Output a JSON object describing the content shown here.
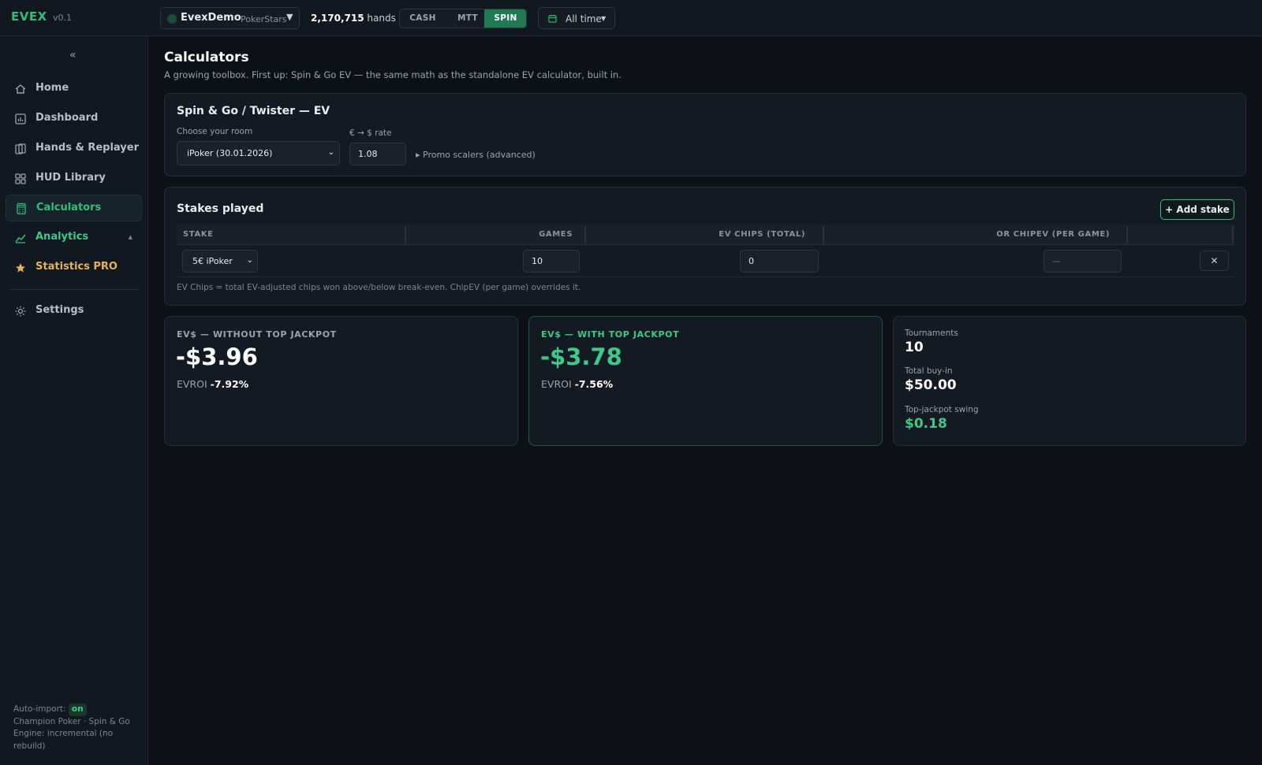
{
  "app": {
    "logo": "EVEX",
    "version": "v0.1"
  },
  "topbar": {
    "account_name": "EvexDemo",
    "account_site": "PokerStars",
    "hands_count": "2,170,715",
    "hands_label": "hands",
    "modes": [
      "CASH",
      "MTT",
      "SPIN"
    ],
    "active_mode": "SPIN",
    "time_filter": "All time",
    "icons": {
      "account": "account-dot-icon",
      "caret": "caret-down-icon",
      "calendar": "calendar-icon"
    }
  },
  "sidebar": {
    "collapse_glyph": "«",
    "items": [
      {
        "label": "Home",
        "icon": "home-icon"
      },
      {
        "label": "Dashboard",
        "icon": "dashboard-icon"
      },
      {
        "label": "Hands & Replayer",
        "icon": "cards-icon"
      },
      {
        "label": "HUD Library",
        "icon": "grid-icon"
      },
      {
        "label": "Calculators",
        "icon": "calculator-icon",
        "active": true
      },
      {
        "label": "Analytics",
        "icon": "line-chart-icon"
      },
      {
        "label": "Statistics PRO",
        "icon": "star-icon"
      },
      {
        "label": "Settings",
        "icon": "gear-icon"
      }
    ],
    "footer": {
      "auto_import_label": "Auto-import:",
      "auto_import_state": "on",
      "import_source": "Champion Poker · Spin & Go",
      "engine": "Engine: incremental (no rebuild)"
    }
  },
  "page": {
    "title": "Calculators",
    "subtitle": "A growing toolbox. First up: Spin & Go EV — the same math as the standalone EV calculator, built in."
  },
  "ev_panel": {
    "title": "Spin & Go / Twister — EV",
    "room_label": "Choose your room",
    "room_value": "iPoker (30.01.2026)",
    "rate_label": "€ → $ rate",
    "rate_value": "1.08",
    "promo_label": "▸ Promo scalers (advanced)"
  },
  "stakes_panel": {
    "title": "Stakes played",
    "add_button": "+ Add stake",
    "columns": [
      "STAKE",
      "GAMES",
      "EV CHIPS (TOTAL)",
      "OR CHIPEV (PER GAME)"
    ],
    "rows": [
      {
        "stake": "5€ iPoker",
        "games": "10",
        "ev_chips": "0",
        "chipev_placeholder": "—"
      }
    ],
    "remove_glyph": "✕",
    "note": "EV Chips = total EV-adjusted chips won above/below break-even. ChipEV (per game) overrides it."
  },
  "results": {
    "without_jackpot": {
      "label": "EV$ — WITHOUT TOP JACKPOT",
      "value": "-$3.96",
      "roi_label": "EVROI",
      "roi_value": "-7.92%"
    },
    "with_jackpot": {
      "label": "EV$ — WITH TOP JACKPOT",
      "value": "-$3.78",
      "roi_label": "EVROI",
      "roi_value": "-7.56%"
    },
    "summary": {
      "tournaments_label": "Tournaments",
      "tournaments_value": "10",
      "buyin_label": "Total buy-in",
      "buyin_value": "$50.00",
      "swing_label": "Top-jackpot swing",
      "swing_value": "$0.18"
    }
  },
  "colors": {
    "accent": "#2fbf7a",
    "pro": "#e3b45c",
    "background": "#0d1117"
  }
}
